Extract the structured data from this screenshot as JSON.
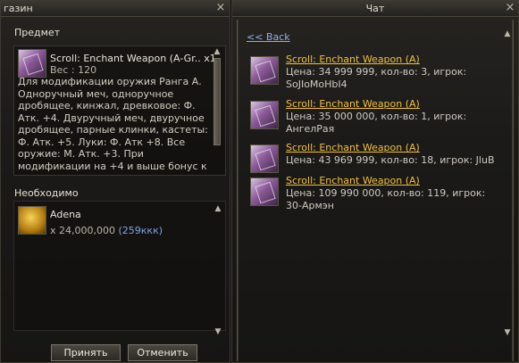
{
  "shop": {
    "title": "газин",
    "section_item": "Предмет",
    "item_name": "Scroll: Enchant Weapon (A-Gr..",
    "item_qty": "x1",
    "weight_label": "Вес :",
    "weight_value": "120",
    "description": [
      "Для модификации оружия Ранга А.",
      "Одноручный меч, одноручное",
      "дробящее, кинжал, древковое: Ф.",
      "Атк. +4. Двуручный меч, двуручное",
      "дробящее, парные клинки, кастеты:",
      "Ф. Атк. +5. Луки: Ф. Атк +8. Все",
      "оружие: М. Атк. +3. При",
      "модификации на +4 и выше бонус к"
    ],
    "section_required": "Необходимо",
    "required_name": "Adena",
    "required_amount": "x 24,000,000",
    "required_note": "(259ккк)",
    "accept_label": "Принять",
    "cancel_label": "Отменить",
    "close_glyph": "×"
  },
  "chat": {
    "title": "Чат",
    "back_label": "<< Back",
    "close_glyph": "×",
    "offers": [
      {
        "name": "Scroll: Enchant Weapon (A)",
        "line2": "Цена: 34 999 999, кол-во: 3, игрок:",
        "line3": "SoJIoMoHbI4"
      },
      {
        "name": "Scroll: Enchant Weapon (A)",
        "line2": "Цена: 35 000 000, кол-во: 1, игрок:",
        "line3": "АнгелРая"
      },
      {
        "name": "Scroll: Enchant Weapon (A)",
        "line2": "Цена: 43 969 999, кол-во: 18, игрок: JluB",
        "line3": ""
      },
      {
        "name": "Scroll: Enchant Weapon (A)",
        "line2": "Цена: 109 990 000, кол-во: 119, игрок:",
        "line3": "30-Армэн"
      }
    ]
  },
  "colors": {
    "item_link": "#f0c13a",
    "back_link": "#8fb1ec",
    "note_blue": "#7fa6e6"
  },
  "icons": {
    "scroll": "enchant-scroll-icon",
    "adena": "adena-coin-icon"
  }
}
